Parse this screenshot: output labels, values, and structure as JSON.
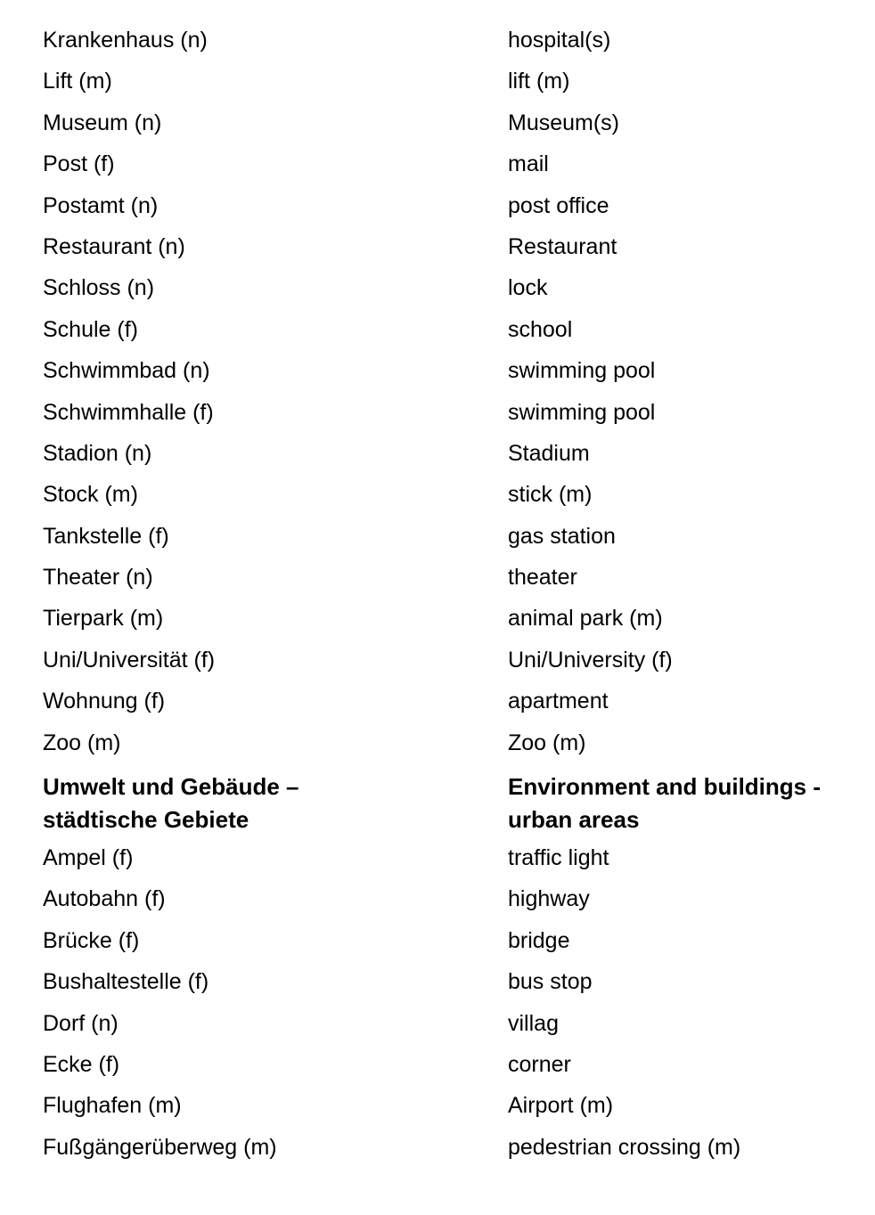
{
  "document": {
    "type": "bilingual-glossary",
    "language_left": "Deutsch",
    "language_right": "English",
    "text_color": "#000000",
    "background_color": "#ffffff"
  },
  "entries_before_heading": [
    {
      "de": "Krankenhaus (n)",
      "en": "hospital(s)"
    },
    {
      "de": "Lift (m)",
      "en": "lift (m)"
    },
    {
      "de": "Museum (n)",
      "en": "Museum(s)"
    },
    {
      "de": "Post (f)",
      "en": "mail"
    },
    {
      "de": "Postamt (n)",
      "en": "post office"
    },
    {
      "de": "Restaurant (n)",
      "en": "Restaurant"
    },
    {
      "de": "Schloss (n)",
      "en": "lock"
    },
    {
      "de": "Schule (f)",
      "en": "school"
    },
    {
      "de": "Schwimmbad (n)",
      "en": "swimming pool"
    },
    {
      "de": "Schwimmhalle (f)",
      "en": "swimming pool"
    },
    {
      "de": "Stadion (n)",
      "en": "Stadium"
    },
    {
      "de": "Stock (m)",
      "en": "stick (m)"
    },
    {
      "de": "Tankstelle (f)",
      "en": "gas station"
    },
    {
      "de": "Theater (n)",
      "en": "theater"
    },
    {
      "de": "Tierpark (m)",
      "en": "animal park (m)"
    },
    {
      "de": "Uni/Universität (f)",
      "en": "Uni/University (f)"
    },
    {
      "de": "Wohnung (f)",
      "en": "apartment"
    },
    {
      "de": "Zoo (m)",
      "en": "Zoo (m)"
    }
  ],
  "section_heading": {
    "de_line1": "Umwelt und Gebäude –",
    "de_line2": "städtische Gebiete",
    "en_line1": "Environment and buildings -",
    "en_line2": "urban areas"
  },
  "entries_after_heading": [
    {
      "de": "Ampel (f)",
      "en": "traffic light"
    },
    {
      "de": "Autobahn (f)",
      "en": "highway"
    },
    {
      "de": "Brücke (f)",
      "en": "bridge"
    },
    {
      "de": "Bushaltestelle (f)",
      "en": "bus stop"
    },
    {
      "de": "Dorf (n)",
      "en": "villag"
    },
    {
      "de": "Ecke (f)",
      "en": "corner"
    },
    {
      "de": "Flughafen (m)",
      "en": "Airport (m)"
    },
    {
      "de": "Fußgängerüberweg (m)",
      "en": "pedestrian crossing (m)"
    }
  ]
}
